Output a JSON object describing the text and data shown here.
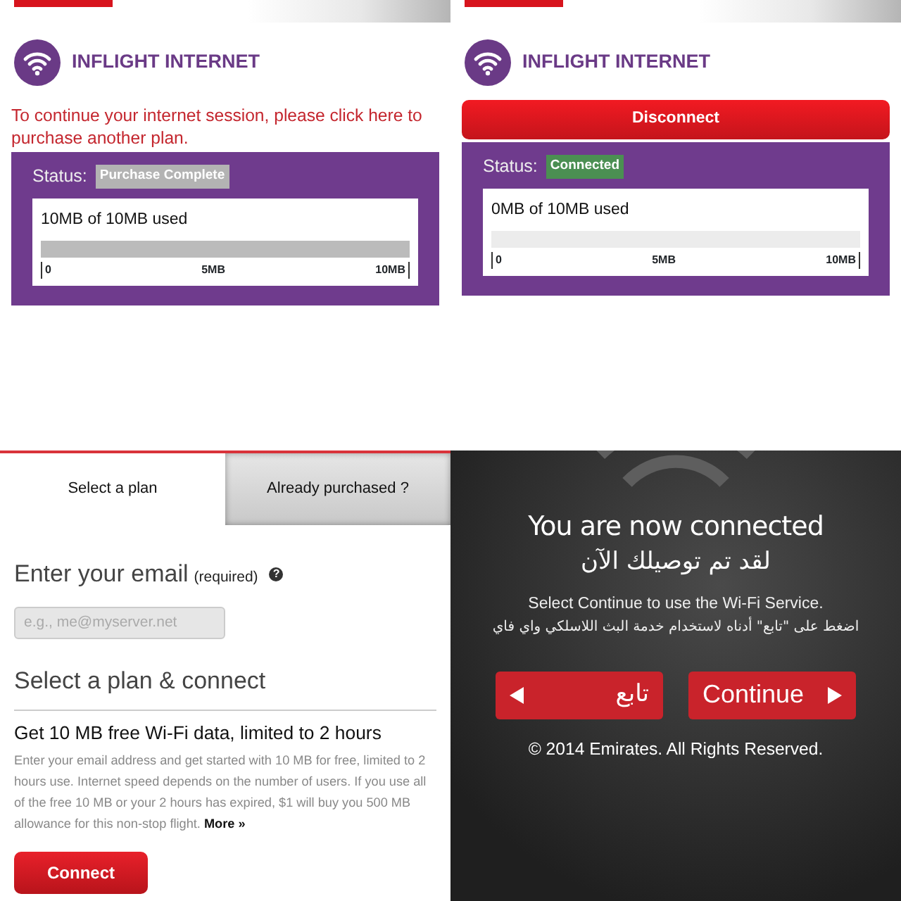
{
  "panels": [
    {
      "kind": "usage",
      "title": "INFLIGHT INTERNET",
      "message": "To continue your internet session, please click here to purchase another plan.",
      "status_label": "Status:",
      "status": {
        "text": "Purchase Complete",
        "color": "#b3b3b3"
      },
      "usage_text": "10MB of 10MB used",
      "level": 1,
      "ticks": [
        "0",
        "5MB",
        "10MB"
      ]
    },
    {
      "kind": "usage",
      "title": "INFLIGHT INTERNET",
      "button": "Disconnect",
      "status_label": "Status:",
      "status": {
        "text": "Connected",
        "color": "#4b8f52"
      },
      "usage_text": "0MB of 10MB used",
      "level": 0,
      "ticks": [
        "0",
        "5MB",
        "10MB"
      ]
    },
    {
      "kind": "plan",
      "tabs": [
        {
          "label": "Select a plan",
          "selected": true
        },
        {
          "label": "Already purchased ?",
          "selected": false
        }
      ],
      "email_heading": "Enter your email",
      "required": "(required)",
      "help_icon": "?",
      "email_placeholder": "e.g., me@myserver.net",
      "plan_heading": "Select a plan & connect",
      "offer_title": "Get 10 MB free Wi-Fi data, limited to 2 hours",
      "offer_text": "Enter your email address and get started with 10 MB for free, limited to 2 hours use. Internet speed depends on the number of users. If you use all of the free 10 MB or your 2 hours has expired, $1 will buy you 500 MB allowance for this non-stop flight.",
      "more_link": "More »",
      "button": "Connect"
    },
    {
      "kind": "connected",
      "title": "You are now connected",
      "title_ar": "لقد تم توصيلك الآن",
      "text": "Select Continue to use the Wi-Fi Service.",
      "text_ar": "اضغط على \"تابع\" أدناه لاستخدام خدمة البث اللاسلكي واي فاي",
      "buttons": [
        {
          "label": "تابع",
          "kind": "back"
        },
        {
          "label": "Continue",
          "kind": "forward"
        }
      ],
      "copyright": "© 2014 Emirates. All Rights Reserved."
    }
  ]
}
